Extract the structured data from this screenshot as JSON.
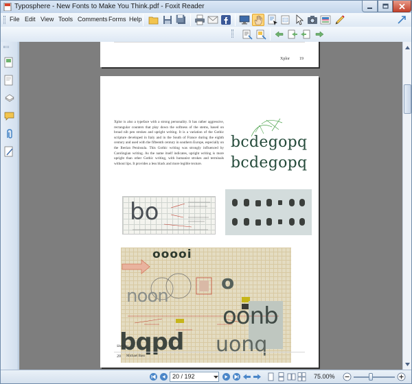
{
  "window": {
    "title": "Typosphere - New Fonts to Make You Think.pdf - Foxit Reader"
  },
  "menu": [
    {
      "label": "File",
      "name": "menu-file"
    },
    {
      "label": "Edit",
      "name": "menu-edit"
    },
    {
      "label": "View",
      "name": "menu-view"
    },
    {
      "label": "Tools",
      "name": "menu-tools"
    },
    {
      "label": "Comments",
      "name": "menu-comments"
    },
    {
      "label": "Forms",
      "name": "menu-forms"
    },
    {
      "label": "Help",
      "name": "menu-help"
    }
  ],
  "document": {
    "top_page_footer": "Xplor",
    "top_page_number": "19",
    "body_text": "Xplor is also a typeface with a strong personality. It has rather aggressive, rectangular counters that play down the softness of the stems, based on broad nib pen strokes and upright writing. It is a variation of the Gothic scripture developed in Italy and in the South of France during the eighth century and used with the fifteenth century in southern Europe, especially on the Iberian Peninsula. This Gothic writing was strongly influenced by Carolingian writing. As the name itself indicates, upright writing is more upright than other Gothic writing, with humanist strokes and terminals without lips. It provides a less black and more legible texture.",
    "specimen_line1": "bcdegopq",
    "specimen_line2": "bcdegopq",
    "sketch_bo": "bo",
    "sketch_ooooi": "ooooi",
    "sketch_noon": "noon",
    "sketch_o": "o",
    "sketch_oonb": "oonb",
    "sketch_bqpd": "bqpd",
    "sketch_uonq": "uonq",
    "caption": "Sketches",
    "page_number": "20",
    "author": "Michael Bass"
  },
  "status": {
    "page_field": "20 / 192",
    "zoom": "75.00%"
  },
  "colors": {
    "accent": "#3d7fc4",
    "close_button": "#c2412c",
    "workspace": "#7e7e7e",
    "sketch_paper": "#e4dcc2"
  }
}
